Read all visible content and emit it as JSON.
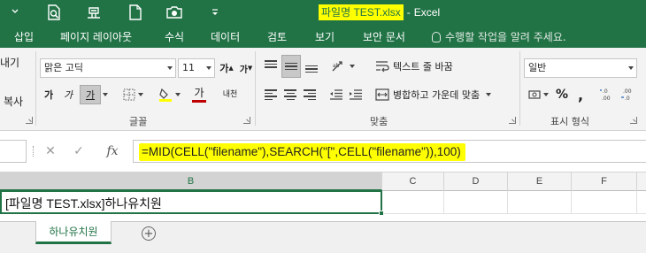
{
  "titlebar": {
    "file_name": "파일명 TEST.xlsx",
    "separator": "-",
    "app_name": "Excel",
    "qat": [
      {
        "icon": "save-icon"
      },
      {
        "icon": "print-preview-icon"
      },
      {
        "icon": "touch-mode-icon"
      },
      {
        "icon": "new-file-icon"
      },
      {
        "icon": "camera-icon"
      },
      {
        "icon": "customize-qat-icon"
      }
    ]
  },
  "tabs": [
    "삽입",
    "페이지 레이아웃",
    "수식",
    "데이터",
    "검토",
    "보기",
    "보안 문서"
  ],
  "tell_me": "수행할 작업을 알려 주세요.",
  "ribbon": {
    "clipboard": {
      "paste_partial": "내기",
      "copy_partial": "복사"
    },
    "font": {
      "font_name": "맑은 고딕",
      "font_size": "11",
      "grow": "가",
      "shrink": "가",
      "bold": "가",
      "italic": "가",
      "underline": "가",
      "font_color_glyph": "가",
      "phonetic": "내천",
      "label": "글꼴"
    },
    "alignment": {
      "wrap_text": "텍스트 줄 바꿈",
      "merge_center": "병합하고 가운데 맞춤",
      "label": "맞춤"
    },
    "number": {
      "format": "일반",
      "label": "표시 형식"
    }
  },
  "formula_bar": {
    "cancel": "✕",
    "enter": "✓",
    "fx": "fx",
    "formula": "=MID(CELL(\"filename\"),SEARCH(\"[\",CELL(\"filename\")),100)"
  },
  "grid": {
    "columns": [
      "B",
      "C",
      "D",
      "E",
      "F"
    ],
    "active_column": "B",
    "cell_b_value": "[파일명 TEST.xlsx]하나유치원"
  },
  "sheets": {
    "active": "하나유치원",
    "add": "+"
  },
  "colors": {
    "accent": "#217346",
    "highlight": "#ffff00",
    "font_color_bar": "#c00000",
    "fill_color_bar": "#ffff00"
  }
}
